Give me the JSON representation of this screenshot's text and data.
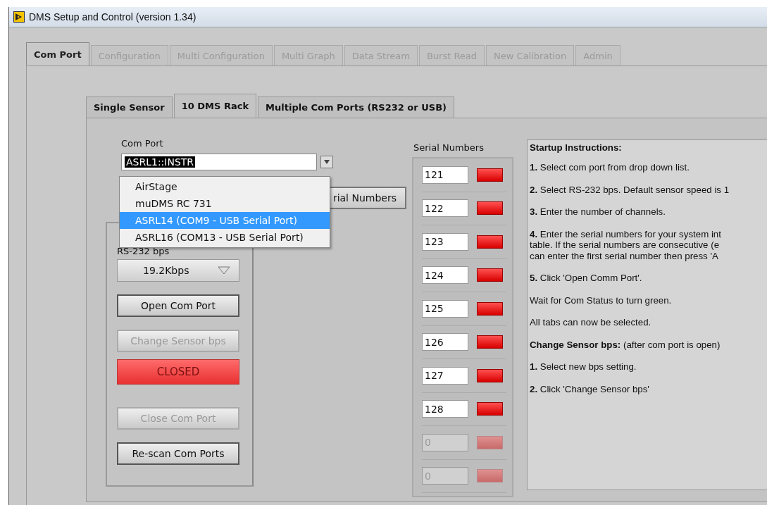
{
  "window": {
    "title": "DMS Setup and Control (version 1.34)"
  },
  "tabs": [
    {
      "label": "Com Port",
      "selected": true,
      "disabled": false
    },
    {
      "label": "Configuration",
      "selected": false,
      "disabled": true
    },
    {
      "label": "Multi Configuration",
      "selected": false,
      "disabled": true
    },
    {
      "label": "Multi Graph",
      "selected": false,
      "disabled": true
    },
    {
      "label": "Data Stream",
      "selected": false,
      "disabled": true
    },
    {
      "label": "Burst Read",
      "selected": false,
      "disabled": true
    },
    {
      "label": "New Calibration",
      "selected": false,
      "disabled": true
    },
    {
      "label": "Admin",
      "selected": false,
      "disabled": true
    }
  ],
  "subtabs": [
    {
      "label": "Single Sensor",
      "selected": false
    },
    {
      "label": "10 DMS Rack",
      "selected": true
    },
    {
      "label": "Multiple Com Ports (RS232 or USB)",
      "selected": false
    }
  ],
  "com_port": {
    "label": "Com Port",
    "value": "ASRL1::INSTR",
    "options": [
      {
        "label": "AirStage",
        "selected": false
      },
      {
        "label": "muDMS RC 731",
        "selected": false
      },
      {
        "label": "ASRL14  (COM9 - USB Serial Port)",
        "selected": true
      },
      {
        "label": "ASRL16  (COM13 - USB Serial Port)",
        "selected": false
      }
    ]
  },
  "serial_numbers_button": "rial Numbers",
  "bps": {
    "label": "RS-232 bps",
    "value": "19.2Kbps"
  },
  "controls": [
    {
      "kind": "button",
      "label": "Open Com Port",
      "disabled": false
    },
    {
      "kind": "button",
      "label": "Change Sensor bps",
      "disabled": true
    },
    {
      "kind": "status",
      "label": "CLOSED",
      "on": false
    },
    {
      "kind": "button",
      "label": "Close Com Port",
      "disabled": true
    },
    {
      "kind": "button",
      "label": "Re-scan Com Ports",
      "disabled": false
    }
  ],
  "serial_numbers": {
    "label": "Serial Numbers",
    "rows": [
      {
        "value": "121",
        "disabled": false
      },
      {
        "value": "122",
        "disabled": false
      },
      {
        "value": "123",
        "disabled": false
      },
      {
        "value": "124",
        "disabled": false
      },
      {
        "value": "125",
        "disabled": false
      },
      {
        "value": "126",
        "disabled": false
      },
      {
        "value": "127",
        "disabled": false
      },
      {
        "value": "128",
        "disabled": false
      },
      {
        "value": "0",
        "disabled": true
      },
      {
        "value": "0",
        "disabled": true
      }
    ]
  },
  "instructions": {
    "title": "Startup Instructions:",
    "paragraphs": [
      [
        "**1.** Select com port from drop down list."
      ],
      [
        "**2.** Select RS-232 bps.  Default sensor speed is 1"
      ],
      [
        "**3.** Enter the number of channels."
      ],
      [
        "**4.** Enter the serial numbers for your system int",
        "table.  If the serial numbers are consecutive (e",
        "can enter the first serial number then press 'A"
      ],
      [
        "**5.** Click 'Open Comm Port'."
      ],
      [
        "Wait for Com Status to turn green."
      ],
      [
        "All tabs can now be selected."
      ],
      [
        "**Change Sensor bps:** (after com port is open)"
      ],
      [
        "**1.** Select new bps setting."
      ],
      [
        "**2.** Click 'Change Sensor bps'"
      ]
    ]
  }
}
